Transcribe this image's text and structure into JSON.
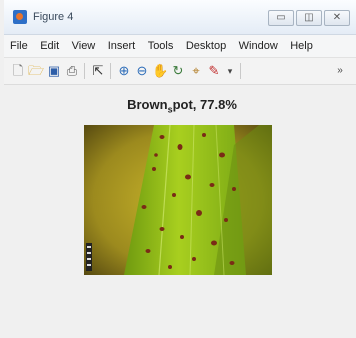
{
  "window": {
    "title": "Figure 4"
  },
  "menubar": [
    "File",
    "Edit",
    "View",
    "Insert",
    "Tools",
    "Desktop",
    "Window",
    "Help"
  ],
  "toolbar_icons": [
    "new-file",
    "open-folder",
    "save",
    "print",
    "pointer",
    "zoom-in",
    "zoom-out",
    "pan",
    "rotate",
    "data-cursor",
    "brush"
  ],
  "figure": {
    "title_main": "Brown",
    "title_subscript": "s",
    "title_rest": "pot, 77.8%"
  },
  "colors": {
    "leaf": "#8fbe14",
    "spot": "#7a2b16",
    "background_leaf": "#b8a227"
  }
}
